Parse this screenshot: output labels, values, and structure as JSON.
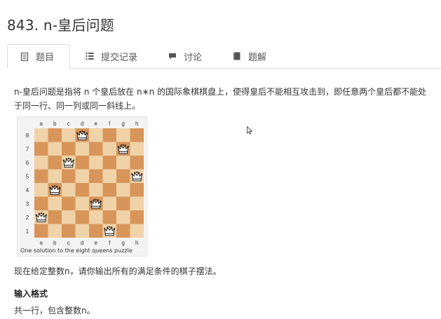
{
  "page_title": "843. n-皇后问题",
  "tabs": [
    {
      "label": "题目",
      "icon": "document-icon",
      "active": true
    },
    {
      "label": "提交记录",
      "icon": "list-icon",
      "active": false
    },
    {
      "label": "讨论",
      "icon": "chat-bubble-icon",
      "active": false
    },
    {
      "label": "题解",
      "icon": "book-icon",
      "active": false
    }
  ],
  "description": "n-皇后问题是指将 n 个皇后放在 n∗n 的国际象棋棋盘上，使得皇后不能相互攻击到，即任意两个皇后都不能处于同一行、同一列或同一斜线上。",
  "figure": {
    "files": [
      "a",
      "b",
      "c",
      "d",
      "e",
      "f",
      "g",
      "h"
    ],
    "ranks": [
      "8",
      "7",
      "6",
      "5",
      "4",
      "3",
      "2",
      "1"
    ],
    "queens": [
      "d8",
      "g7",
      "c6",
      "h5",
      "b4",
      "e3",
      "a2",
      "f1"
    ],
    "caption": "One solution to the eight queens puzzle",
    "light_color": "#f0d2a8",
    "dark_color": "#d7955a"
  },
  "paragraph": "现在给定整数n，请你输出所有的满足条件的棋子摆法。",
  "input_heading": "输入格式",
  "input_text": "共一行，包含整数n。"
}
